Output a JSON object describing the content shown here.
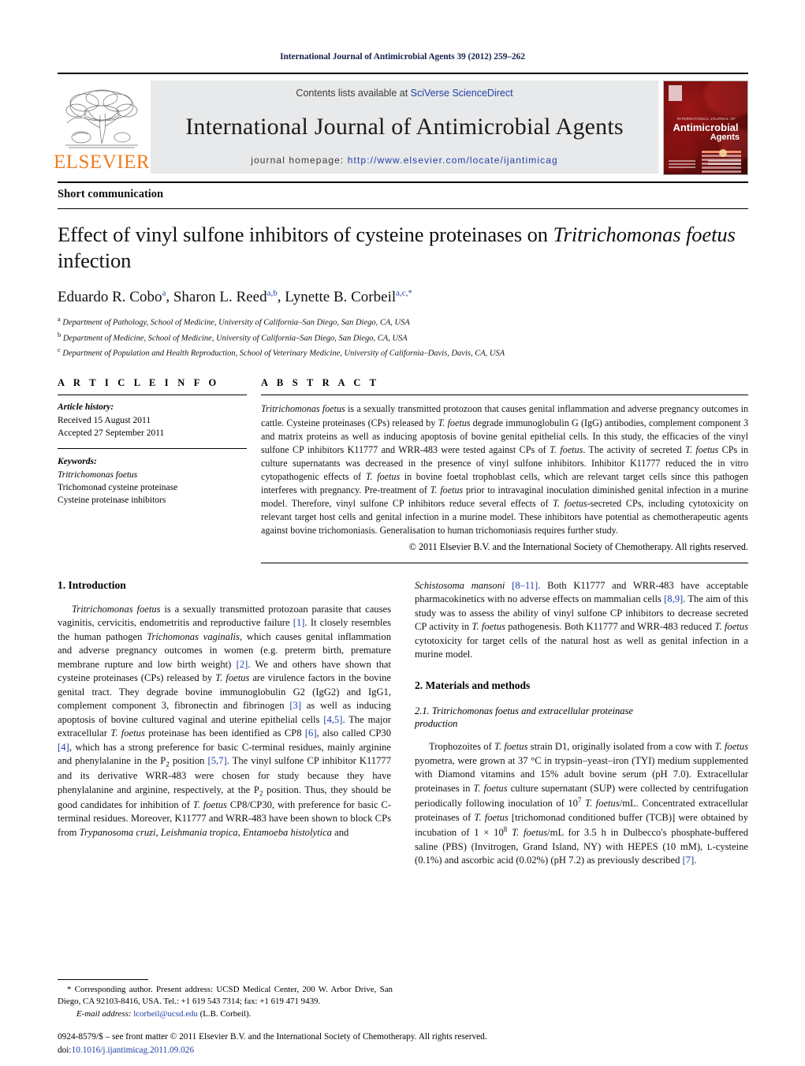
{
  "running_head": "International Journal of Antimicrobial Agents 39 (2012) 259–262",
  "masthead": {
    "publisher_wordmark": "ELSEVIER",
    "contents_prefix": "Contents lists available at ",
    "contents_link": "SciVerse ScienceDirect",
    "journal_title": "International Journal of Antimicrobial Agents",
    "homepage_prefix": "journal homepage: ",
    "homepage_url": "http://www.elsevier.com/locate/ijantimicag",
    "cover": {
      "kicker": "INTERNATIONAL JOURNAL OF",
      "line1": "Antimicrobial",
      "line2": "Agents"
    }
  },
  "article_type": "Short communication",
  "title_plain": "Effect of vinyl sulfone inhibitors of cysteine proteinases on ",
  "title_italic": "Tritrichomonas foetus",
  "title_tail": " infection",
  "authors": [
    {
      "name": "Eduardo R. Cobo",
      "marks": "a"
    },
    {
      "name": "Sharon L. Reed",
      "marks": "a,b"
    },
    {
      "name": "Lynette B. Corbeil",
      "marks": "a,c,*"
    }
  ],
  "affiliations": [
    {
      "mark": "a",
      "text": "Department of Pathology, School of Medicine, University of California–San Diego, San Diego, CA, USA"
    },
    {
      "mark": "b",
      "text": "Department of Medicine, School of Medicine, University of California–San Diego, San Diego, CA, USA"
    },
    {
      "mark": "c",
      "text": "Department of Population and Health Reproduction, School of Veterinary Medicine, University of California–Davis, Davis, CA, USA"
    }
  ],
  "article_info": {
    "heading": "A R T I C L E   I N F O",
    "history_label": "Article history:",
    "received": "Received 15 August 2011",
    "accepted": "Accepted 27 September 2011",
    "keywords_label": "Keywords:",
    "keywords": [
      "Tritrichomonas foetus",
      "Trichomonad cysteine proteinase",
      "Cysteine proteinase inhibitors"
    ]
  },
  "abstract": {
    "heading": "A B S T R A C T",
    "text_parts": [
      {
        "t": "Tritrichomonas foetus",
        "i": true
      },
      {
        "t": " is a sexually transmitted protozoon that causes genital inflammation and adverse pregnancy outcomes in cattle. Cysteine proteinases (CPs) released by ",
        "i": false
      },
      {
        "t": "T. foetus",
        "i": true
      },
      {
        "t": " degrade immunoglobulin G (IgG) antibodies, complement component 3 and matrix proteins as well as inducing apoptosis of bovine genital epithelial cells. In this study, the efficacies of the vinyl sulfone CP inhibitors K11777 and WRR-483 were tested against CPs of ",
        "i": false
      },
      {
        "t": "T. foetus",
        "i": true
      },
      {
        "t": ". The activity of secreted ",
        "i": false
      },
      {
        "t": "T. foetus",
        "i": true
      },
      {
        "t": " CPs in culture supernatants was decreased in the presence of vinyl sulfone inhibitors. Inhibitor K11777 reduced the in vitro cytopathogenic effects of ",
        "i": false
      },
      {
        "t": "T. foetus",
        "i": true
      },
      {
        "t": " in bovine foetal trophoblast cells, which are relevant target cells since this pathogen interferes with pregnancy. Pre-treatment of ",
        "i": false
      },
      {
        "t": "T. foetus",
        "i": true
      },
      {
        "t": " prior to intravaginal inoculation diminished genital infection in a murine model. Therefore, vinyl sulfone CP inhibitors reduce several effects of ",
        "i": false
      },
      {
        "t": "T. foetus",
        "i": true
      },
      {
        "t": "-secreted CPs, including cytotoxicity on relevant target host cells and genital infection in a murine model. These inhibitors have potential as chemotherapeutic agents against bovine trichomoniasis. Generalisation to human trichomoniasis requires further study.",
        "i": false
      }
    ],
    "copyright": "© 2011 Elsevier B.V. and the International Society of Chemotherapy. All rights reserved."
  },
  "sections": {
    "introduction_heading": "1.  Introduction",
    "methods_heading": "2.  Materials and methods",
    "methods_sub_line1": "2.1.  Tritrichomonas foetus and extracellular proteinase",
    "methods_sub_line2": "production"
  },
  "intro_paragraph": [
    {
      "t": "Tritrichomonas foetus",
      "i": true
    },
    {
      "t": " is a sexually transmitted protozoan parasite that causes vaginitis, cervicitis, endometritis and reproductive failure ",
      "i": false
    },
    {
      "t": "[1]",
      "r": true
    },
    {
      "t": ". It closely resembles the human pathogen ",
      "i": false
    },
    {
      "t": "Trichomonas vaginalis",
      "i": true
    },
    {
      "t": ", which causes genital inflammation and adverse pregnancy outcomes in women (e.g. preterm birth, premature membrane rupture and low birth weight) ",
      "i": false
    },
    {
      "t": "[2]",
      "r": true
    },
    {
      "t": ". We and others have shown that cysteine proteinases (CPs) released by ",
      "i": false
    },
    {
      "t": "T. foetus",
      "i": true
    },
    {
      "t": " are virulence factors in the bovine genital tract. They degrade bovine immunoglobulin G2 (IgG2) and IgG1, complement component 3, fibronectin and fibrinogen ",
      "i": false
    },
    {
      "t": "[3]",
      "r": true
    },
    {
      "t": " as well as inducing apoptosis of bovine cultured vaginal and uterine epithelial cells ",
      "i": false
    },
    {
      "t": "[4,5]",
      "r": true
    },
    {
      "t": ". The major extracellular ",
      "i": false
    },
    {
      "t": "T. foetus",
      "i": true
    },
    {
      "t": " proteinase has been identified as CP8 ",
      "i": false
    },
    {
      "t": "[6]",
      "r": true
    },
    {
      "t": ", also called CP30 ",
      "i": false
    },
    {
      "t": "[4]",
      "r": true
    },
    {
      "t": ", which has a strong preference for basic C-terminal residues, mainly arginine and phenylalanine in the P",
      "i": false
    },
    {
      "t": "2",
      "sub": true
    },
    {
      "t": " position ",
      "i": false
    },
    {
      "t": "[5,7]",
      "r": true
    },
    {
      "t": ". The vinyl sulfone CP inhibitor K11777 and its derivative WRR-483 were chosen for study because they have phenylalanine and arginine, respectively, at the P",
      "i": false
    },
    {
      "t": "2",
      "sub": true
    },
    {
      "t": " position. Thus, they should be good candidates for inhibition of ",
      "i": false
    },
    {
      "t": "T. foetus",
      "i": true
    },
    {
      "t": " CP8/CP30, with preference for basic C-terminal residues. Moreover, K11777 and WRR-483 have been shown to block CPs from ",
      "i": false
    },
    {
      "t": "Trypanosoma cruzi, Leishmania tropica, Entamoeba histolytica",
      "i": true
    },
    {
      "t": " and ",
      "i": false
    },
    {
      "t": "Schistosoma mansoni",
      "i": true
    },
    {
      "t": " ",
      "i": false
    },
    {
      "t": "[8–11]",
      "r": true
    },
    {
      "t": ". Both K11777 and WRR-483 have acceptable pharmacokinetics with no adverse effects on mammalian cells ",
      "i": false
    },
    {
      "t": "[8,9]",
      "r": true
    },
    {
      "t": ". The aim of this study was to assess the ability of vinyl sulfone CP inhibitors to decrease secreted CP activity in ",
      "i": false
    },
    {
      "t": "T. foetus",
      "i": true
    },
    {
      "t": " pathogenesis. Both K11777 and WRR-483 reduced ",
      "i": false
    },
    {
      "t": "T. foetus",
      "i": true
    },
    {
      "t": " cytotoxicity for target cells of the natural host as well as genital infection in a murine model.",
      "i": false
    }
  ],
  "methods_paragraph": [
    {
      "t": "Trophozoites of ",
      "i": false
    },
    {
      "t": "T. foetus",
      "i": true
    },
    {
      "t": " strain D1, originally isolated from a cow with ",
      "i": false
    },
    {
      "t": "T. foetus",
      "i": true
    },
    {
      "t": " pyometra, were grown at 37 °C in trypsin–yeast–iron (TYI) medium supplemented with Diamond vitamins and 15% adult bovine serum (pH 7.0). Extracellular proteinases in ",
      "i": false
    },
    {
      "t": "T. foetus",
      "i": true
    },
    {
      "t": " culture supernatant (SUP) were collected by centrifugation periodically following inoculation of 10",
      "i": false
    },
    {
      "t": "7",
      "sup": true
    },
    {
      "t": " ",
      "i": false
    },
    {
      "t": "T. foetus",
      "i": true
    },
    {
      "t": "/mL. Concentrated extracellular proteinases of ",
      "i": false
    },
    {
      "t": "T. foetus",
      "i": true
    },
    {
      "t": " [trichomonad conditioned buffer (TCB)] were obtained by incubation of 1 × 10",
      "i": false
    },
    {
      "t": "8",
      "sup": true
    },
    {
      "t": " ",
      "i": false
    },
    {
      "t": "T. foetus",
      "i": true
    },
    {
      "t": "/mL for 3.5 h in Dulbecco's phosphate-buffered saline (PBS) (Invitrogen, Grand Island, NY) with HEPES (10 mM), ",
      "i": false
    },
    {
      "t": "L",
      "sc": true
    },
    {
      "t": "-cysteine (0.1%) and ascorbic acid (0.02%) (pH 7.2) as previously described ",
      "i": false
    },
    {
      "t": "[7]",
      "r": true
    },
    {
      "t": ".",
      "i": false
    }
  ],
  "footnote": {
    "line1": "* Corresponding author. Present address: UCSD Medical Center, 200 W. Arbor Drive, San Diego, CA 92103-8416, USA. Tel.: +1 619 543 7314; fax: +1 619 471 9439.",
    "email_label": "E-mail address:",
    "email": "lcorbeil@ucsd.edu",
    "email_owner": "(L.B. Corbeil)."
  },
  "imprint": {
    "line1": "0924-8579/$ – see front matter © 2011 Elsevier B.V. and the International Society of Chemotherapy. All rights reserved.",
    "doi_label": "doi:",
    "doi": "10.1016/j.ijantimicag.2011.09.026"
  }
}
